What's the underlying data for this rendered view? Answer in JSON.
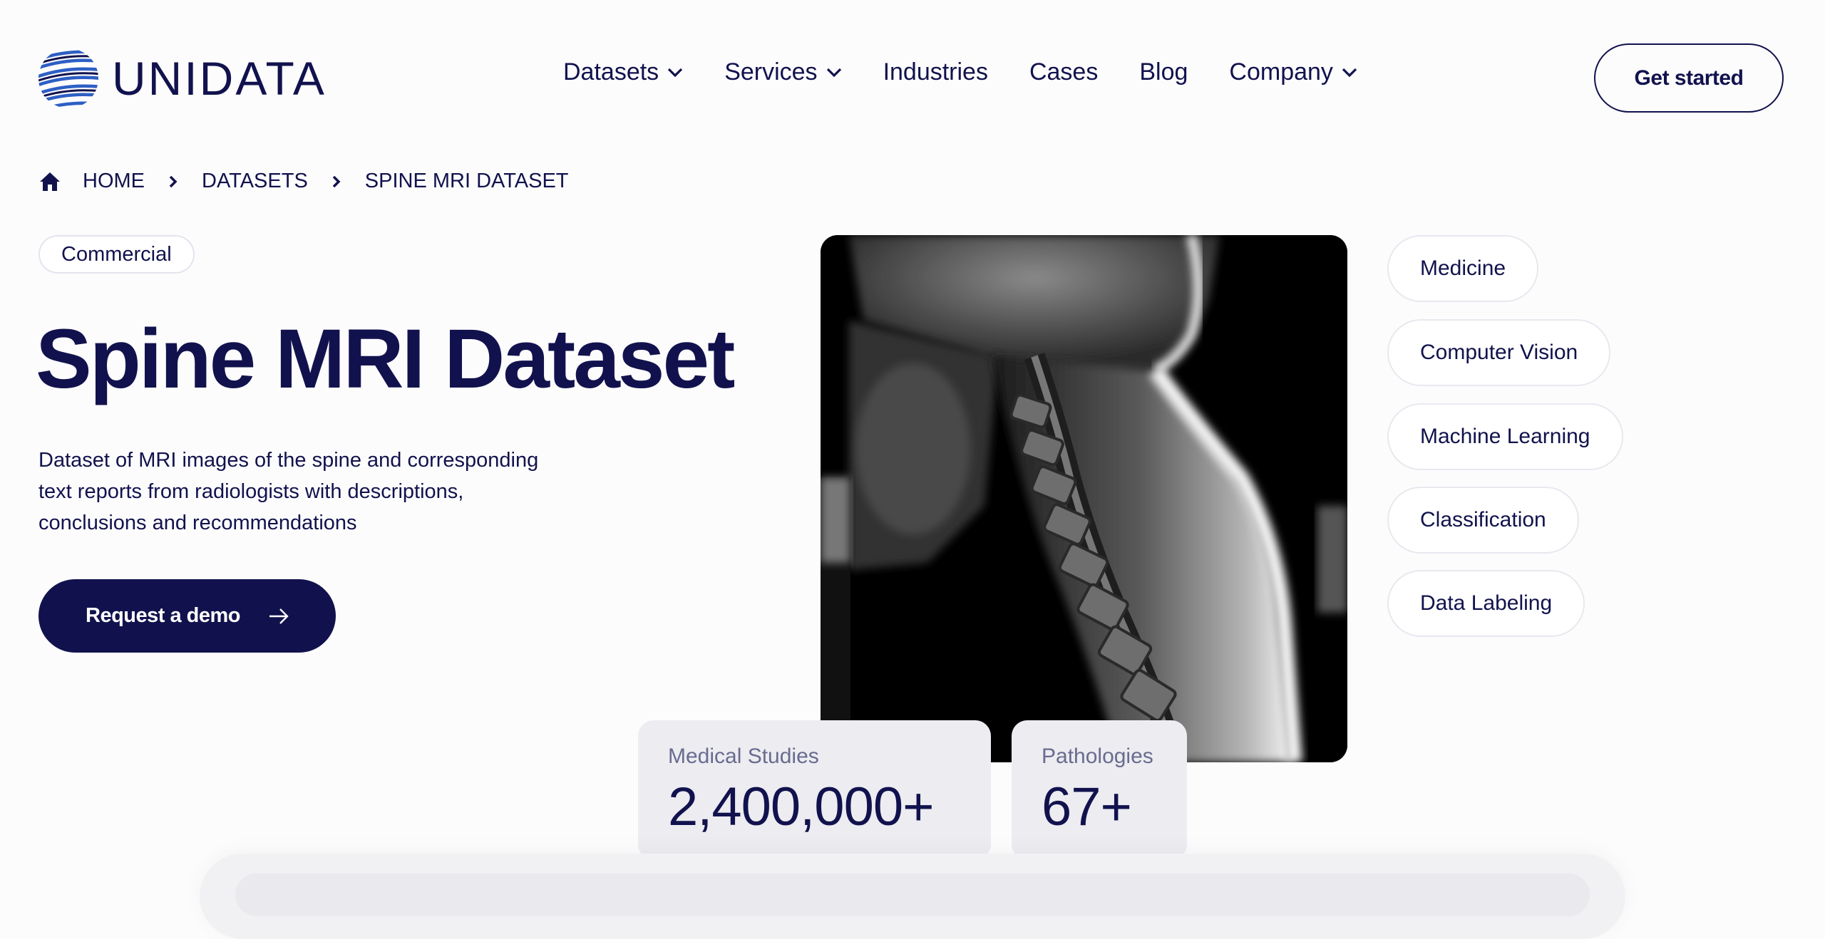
{
  "brand": {
    "name": "UNIDATA"
  },
  "nav": {
    "items": [
      {
        "label": "Datasets",
        "dropdown": true
      },
      {
        "label": "Services",
        "dropdown": true
      },
      {
        "label": "Industries",
        "dropdown": false
      },
      {
        "label": "Cases",
        "dropdown": false
      },
      {
        "label": "Blog",
        "dropdown": false
      },
      {
        "label": "Company",
        "dropdown": true
      }
    ],
    "cta_label": "Get started"
  },
  "breadcrumb": {
    "home": "HOME",
    "datasets": "DATASETS",
    "current": "SPINE MRI DATASET"
  },
  "hero": {
    "badge": "Commercial",
    "title": "Spine MRI Dataset",
    "description": "Dataset of MRI images of the spine and corresponding text reports from radiologists with descriptions, conclusions and recommendations",
    "cta_label": "Request a demo"
  },
  "tags": [
    "Medicine",
    "Computer Vision",
    "Machine Learning",
    "Classification",
    "Data Labeling"
  ],
  "stats": {
    "studies": {
      "label": "Medical Studies",
      "value": "2,400,000+"
    },
    "pathologies": {
      "label": "Pathologies",
      "value": "67+"
    }
  },
  "colors": {
    "primary": "#11124d",
    "background": "#fdfcfd",
    "stat_bg": "#ececf1"
  }
}
